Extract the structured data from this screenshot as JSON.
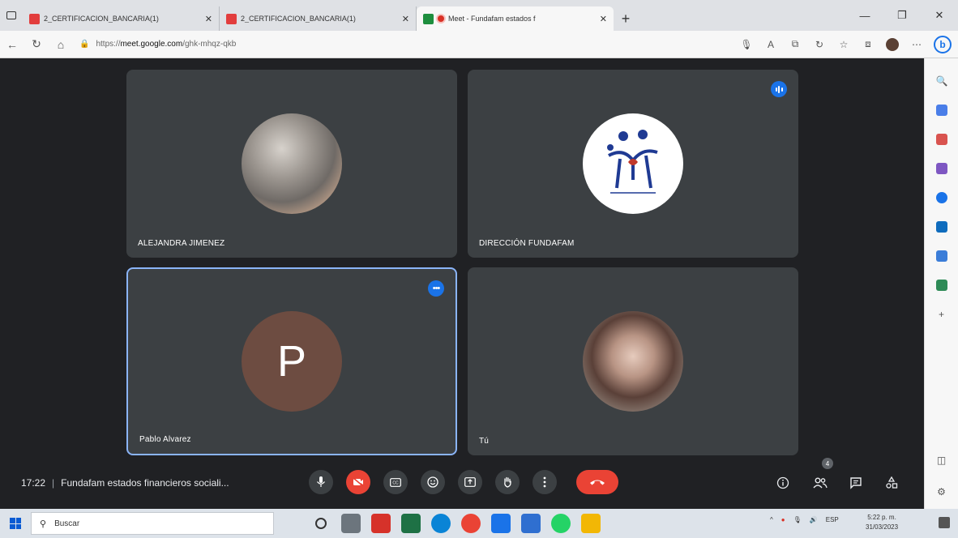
{
  "browser": {
    "tabs": [
      {
        "title": "2_CERTIFICACION_BANCARIA(1)",
        "kind": "pdf",
        "active": false
      },
      {
        "title": "2_CERTIFICACION_BANCARIA(1)",
        "kind": "pdf",
        "active": false
      },
      {
        "title": "Meet - Fundafam estados f",
        "kind": "meet",
        "active": true
      }
    ],
    "tab_close": "✕",
    "new_tab": "+",
    "window_controls": {
      "minimize": "—",
      "maximize": "❐",
      "close": "✕"
    },
    "address": {
      "prefix": "https://",
      "host": "meet.google.com",
      "path": "/ghk-mhqz-qkb"
    }
  },
  "tiles": [
    {
      "name": "ALEJANDRA JIMENEZ",
      "avatar": "photo"
    },
    {
      "name": "DIRECCIÓN FUNDAFAM",
      "avatar": "logo",
      "speaking": true
    },
    {
      "name": "Pablo Alvarez",
      "avatar": "letter",
      "letter": "P",
      "pinned_outline": true
    },
    {
      "name": "Tú",
      "avatar": "photo"
    }
  ],
  "meeting": {
    "time": "17:22",
    "separator": "|",
    "title": "Fundafam estados financieros sociali..."
  },
  "controls": {
    "participants_count": "4"
  },
  "taskbar": {
    "search_placeholder": "Buscar",
    "language": "ESP",
    "time": "5:22 p. m.",
    "date": "31/03/2023"
  },
  "colors": {
    "meet_bg": "#202124",
    "tile_bg": "#3c4043",
    "accent_blue": "#1a73e8",
    "hangup_red": "#ea4335",
    "pinned_outline": "#8ab4f8",
    "letter_avatar": "#6d4c41"
  },
  "icons": [
    "microphone-icon",
    "camera-off-icon",
    "captions-icon",
    "emoji-icon",
    "present-icon",
    "raise-hand-icon",
    "more-options-icon",
    "hangup-icon",
    "info-icon",
    "people-icon",
    "chat-icon",
    "activities-icon"
  ]
}
